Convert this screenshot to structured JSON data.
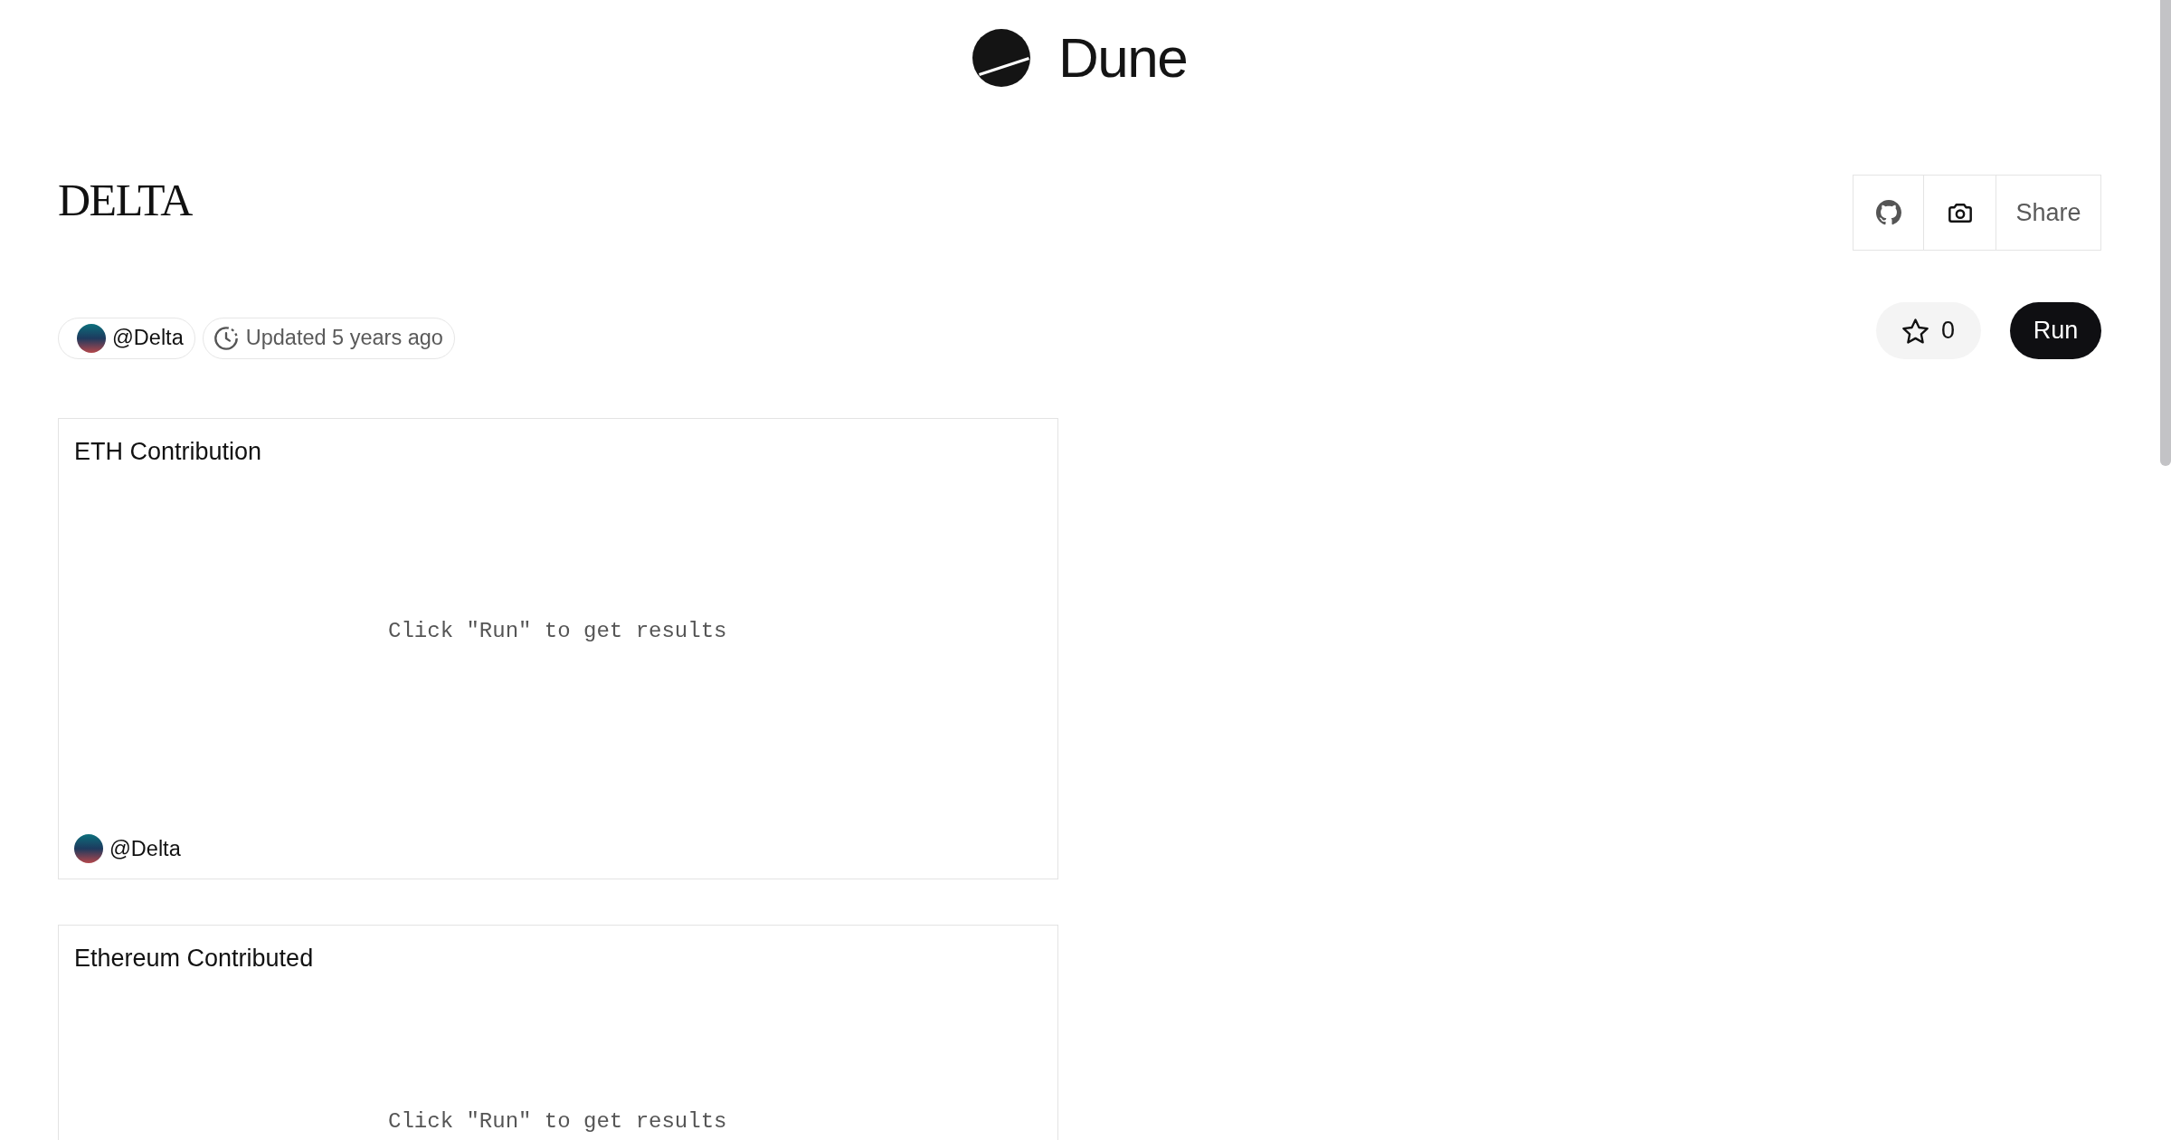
{
  "header": {
    "logo_text": "Dune"
  },
  "dashboard": {
    "title": "DELTA",
    "owner": "@Delta",
    "updated": "Updated 5 years ago",
    "actions": {
      "share_label": "Share",
      "starred": false,
      "star_count": "0",
      "run_label": "Run"
    }
  },
  "widgets": [
    {
      "title": "ETH Contribution",
      "message": "Click \"Run\" to get results",
      "author": "@Delta"
    },
    {
      "title": "Ethereum Contributed",
      "message": "Click \"Run\" to get results"
    }
  ]
}
